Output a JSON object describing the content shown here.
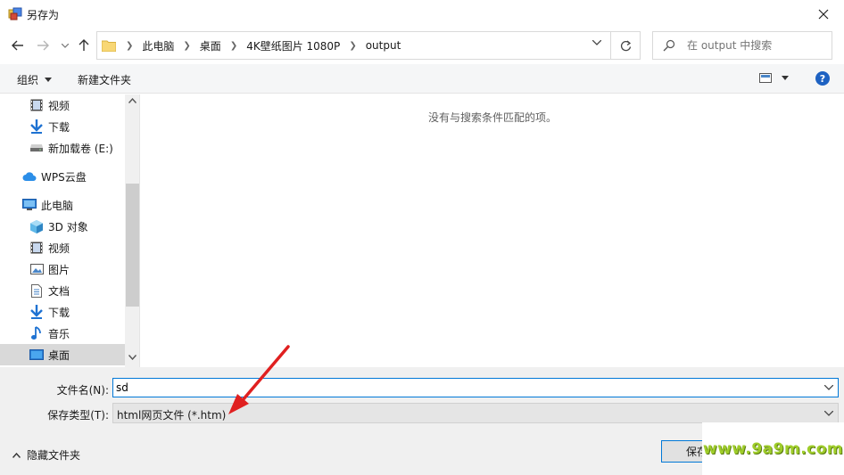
{
  "window": {
    "title": "另存为",
    "close_icon": "close-icon"
  },
  "address": {
    "crumbs": [
      "此电脑",
      "桌面",
      "4K壁纸图片 1080P",
      "output"
    ]
  },
  "search": {
    "placeholder": "在 output 中搜索"
  },
  "toolbar": {
    "organize_label": "组织",
    "new_folder_label": "新建文件夹",
    "help_label": "?"
  },
  "nav": {
    "items": [
      {
        "label": "视频",
        "icon": "video-icon"
      },
      {
        "label": "下载",
        "icon": "download-icon"
      },
      {
        "label": "新加载卷 (E:)",
        "icon": "drive-icon"
      },
      {
        "label": "WPS云盘",
        "icon": "cloud-icon"
      },
      {
        "label": "此电脑",
        "icon": "computer-icon"
      },
      {
        "label": "3D 对象",
        "icon": "3d-objects-icon"
      },
      {
        "label": "视频",
        "icon": "video-icon"
      },
      {
        "label": "图片",
        "icon": "picture-icon"
      },
      {
        "label": "文档",
        "icon": "document-icon"
      },
      {
        "label": "下载",
        "icon": "download-icon"
      },
      {
        "label": "音乐",
        "icon": "music-icon"
      },
      {
        "label": "桌面",
        "icon": "desktop-icon",
        "selected": true
      }
    ]
  },
  "content": {
    "empty_message": "没有与搜索条件匹配的项。"
  },
  "form": {
    "filename_label": "文件名(N):",
    "filename_value": "sd",
    "filetype_label": "保存类型(T):",
    "filetype_value": "html网页文件 (*.htm)"
  },
  "footer": {
    "hide_folders_label": "隐藏文件夹",
    "save_label": "保存"
  },
  "watermark": {
    "text": "www.9a9m.com"
  },
  "colors": {
    "accent": "#0078d7",
    "annotation_arrow": "#e02020",
    "watermark": "#9fcd2a"
  }
}
